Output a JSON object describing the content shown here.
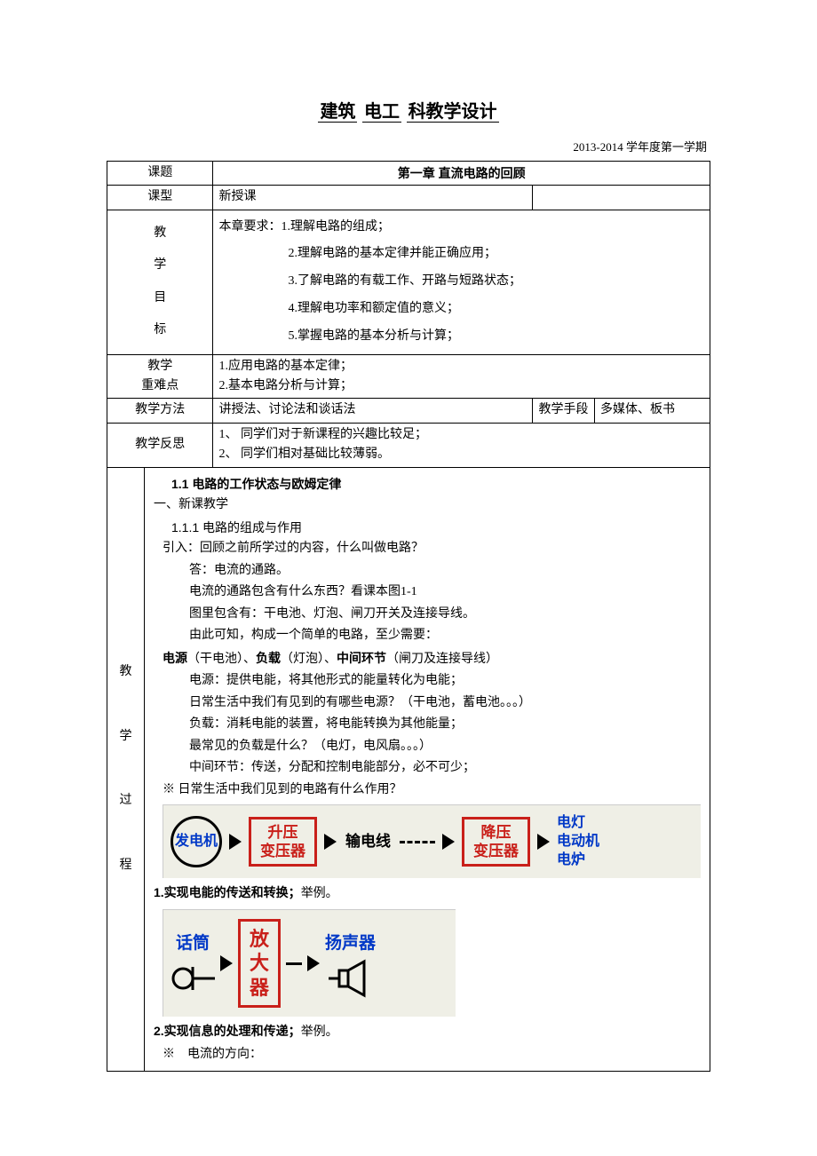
{
  "title": {
    "prefix": "建筑",
    "mid": "电工",
    "suffix": "科教学设计"
  },
  "semester": "2013-2014 学年度第一学期",
  "row_labels": {
    "topic": "课题",
    "type": "课型",
    "goal_l1": "教",
    "goal_l2": "学",
    "goal_l3": "目",
    "goal_l4": "标",
    "keypoint_l1": "教学",
    "keypoint_l2": "重难点",
    "method": "教学方法",
    "means": "教学手段",
    "reflect": "教学反思",
    "proc_l1": "教",
    "proc_l2": "学",
    "proc_l3": "过",
    "proc_l4": "程"
  },
  "topic": "第一章 直流电路的回顾",
  "type": "新授课",
  "goals": {
    "lead": "本章要求：1.理解电路的组成；",
    "g2": "2.理解电路的基本定律并能正确应用；",
    "g3": "3.了解电路的有载工作、开路与短路状态；",
    "g4": "4.理解电功率和额定值的意义；",
    "g5": "5.掌握电路的基本分析与计算；"
  },
  "keypoints": {
    "k1": "1.应用电路的基本定律；",
    "k2": "2.基本电路分析与计算；"
  },
  "method": "讲授法、讨论法和谈话法",
  "means": "多媒体、板书",
  "reflect": {
    "r1": "1、 同学们对于新课程的兴趣比较足；",
    "r2": "2、 同学们相对基础比较薄弱。"
  },
  "content": {
    "h1": "1.1 电路的工作状态与欧姆定律",
    "s1": "一、新课教学",
    "h2": "1.1.1 电路的组成与作用",
    "l1": "引入：回顾之前所学过的内容，什么叫做电路？",
    "l2": "答：电流的通路。",
    "l3": "电流的通路包含有什么东西？看课本图1-1",
    "l4": "图里包含有：干电池、灯泡、闸刀开关及连接导线。",
    "l5": "由此可知，构成一个简单的电路，至少需要：",
    "l6a": "电源",
    "l6b": "（干电池）、",
    "l6c": "负载",
    "l6d": "（灯泡）、",
    "l6e": "中间环节",
    "l6f": "（闸刀及连接导线）",
    "l7": "电源：提供电能，将其他形式的能量转化为电能；",
    "l8": "日常生活中我们有见到的有哪些电源？（干电池，蓄电池。。。）",
    "l9": "负载：消耗电能的装置，将电能转换为其他能量；",
    "l10": "最常见的负载是什么？（电灯，电风扇。。。）",
    "l11": "中间环节：传送，分配和控制电能部分，必不可少；",
    "l12": "※ 日常生活中我们见到的电路有什么作用？",
    "p1": "1.实现电能的传送和转换；",
    "p1b": "举例。",
    "p2": "2.实现信息的处理和传递；",
    "p2b": "举例。",
    "l13": "※　电流的方向："
  },
  "diagram1": {
    "gen": "发电机",
    "up_trans_l1": "升压",
    "up_trans_l2": "变压器",
    "wire": "输电线",
    "down_trans_l1": "降压",
    "down_trans_l2": "变压器",
    "load_l1": "电灯",
    "load_l2": "电动机",
    "load_l3": "电炉"
  },
  "diagram2": {
    "mic": "话筒",
    "amp_l1": "放",
    "amp_l2": "大",
    "amp_l3": "器",
    "speaker": "扬声器"
  }
}
